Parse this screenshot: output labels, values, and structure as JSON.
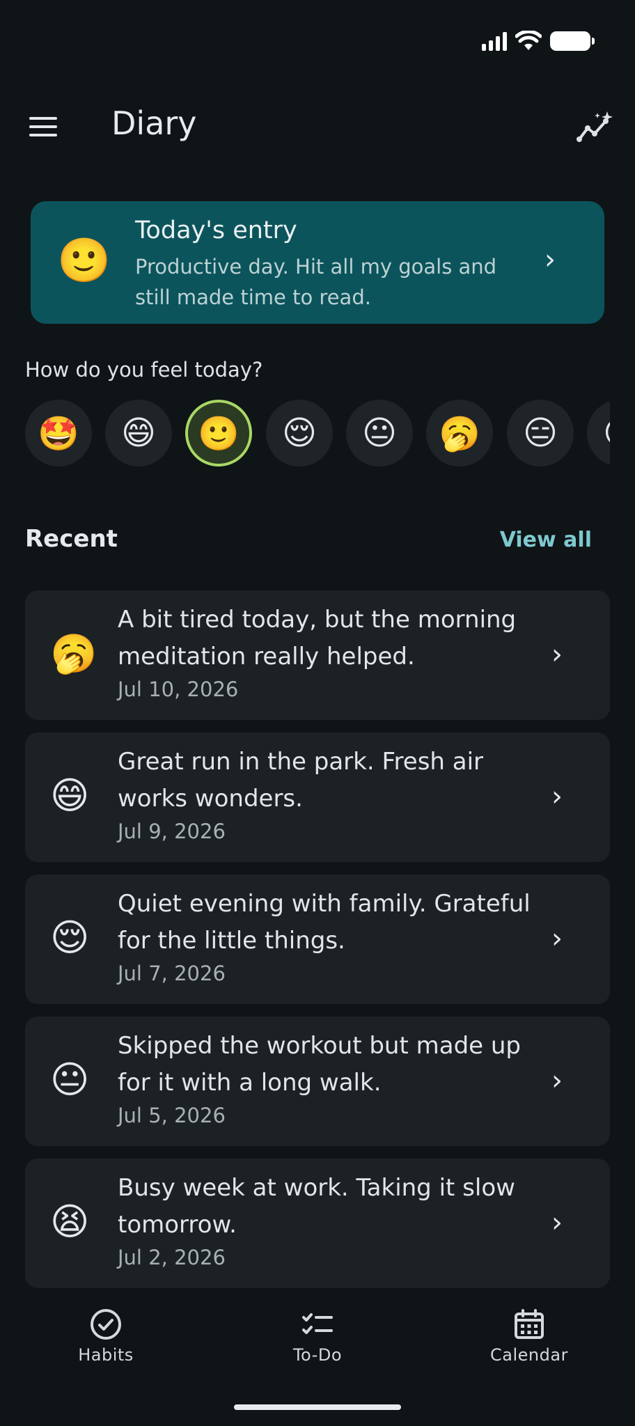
{
  "app_bar": {
    "title": "Diary",
    "menu_icon": "menu-icon",
    "insights_icon": "insights-sparkle-icon"
  },
  "today": {
    "title": "Today's entry",
    "text": "Productive day. Hit all my goals and still made time to read.",
    "emoji": "🙂"
  },
  "feel": {
    "label": "How do you feel today?",
    "moods": [
      "🤩",
      "😄",
      "🙂",
      "😌",
      "😐",
      "🥱",
      "😑",
      "😢"
    ],
    "selected_index": 2
  },
  "recent": {
    "label": "Recent",
    "view_all": "View all",
    "entries": [
      {
        "emoji": "🥱",
        "text": "A bit tired today, but the morning meditation really helped.",
        "date": "Jul 10, 2026"
      },
      {
        "emoji": "😄",
        "text": "Great run in the park. Fresh air works wonders.",
        "date": "Jul 9, 2026"
      },
      {
        "emoji": "😌",
        "text": "Quiet evening with family. Grateful for the little things.",
        "date": "Jul 7, 2026"
      },
      {
        "emoji": "😐",
        "text": "Skipped the workout but made up for it with a long walk.",
        "date": "Jul 5, 2026"
      },
      {
        "emoji": "😫",
        "text": "Busy week at work. Taking it slow tomorrow.",
        "date": "Jul 2, 2026"
      }
    ]
  },
  "nav": {
    "habits": "Habits",
    "todo": "To-Do",
    "calendar": "Calendar"
  },
  "colors": {
    "background": "#0f1417",
    "today_card": "#0c545c",
    "accent": "#7fc8cf",
    "selected_ring": "#a9d865"
  }
}
